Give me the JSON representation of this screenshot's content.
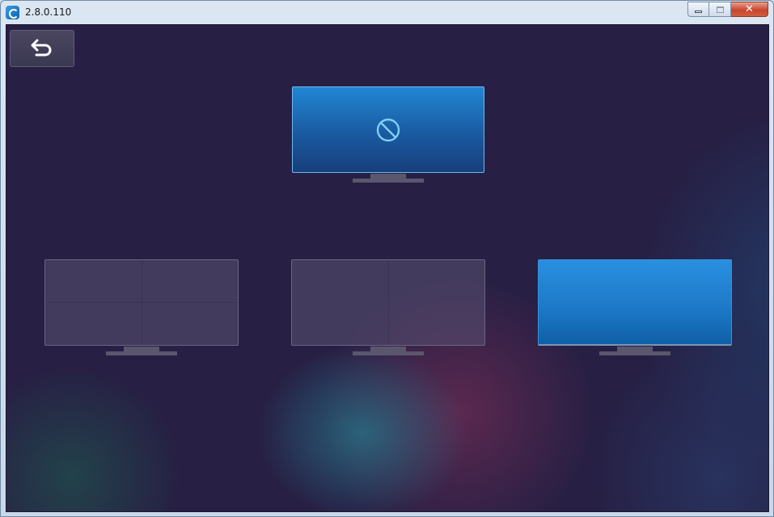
{
  "window": {
    "title": "2.8.0.110",
    "app_icon": "app-logo-icon",
    "controls": {
      "minimize_icon": "minimize-icon",
      "maximize_icon": "maximize-icon",
      "close_glyph": "✕"
    }
  },
  "back_button": {
    "icon": "back-arrow-icon"
  },
  "layouts": [
    {
      "id": "disabled",
      "icon": "prohibited-icon",
      "selected": true,
      "panes": 1
    },
    {
      "id": "quad",
      "selected": false,
      "panes": 4
    },
    {
      "id": "dual",
      "selected": false,
      "panes": 2
    },
    {
      "id": "single",
      "selected": false,
      "panes": 1
    }
  ],
  "colors": {
    "background": "#271f44",
    "active_screen": "#2186d4",
    "inactive_screen": "#5a5273",
    "single_screen": "#1c78c6"
  }
}
